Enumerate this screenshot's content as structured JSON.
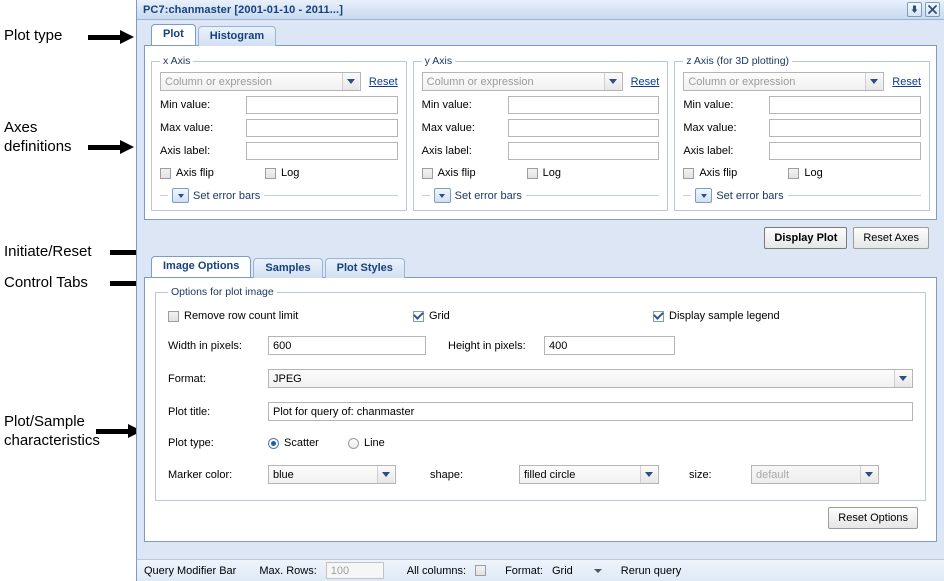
{
  "annotations": [
    {
      "text": "Plot type"
    },
    {
      "text": "Axes\ndefinitions"
    },
    {
      "text": "Initiate/Reset"
    },
    {
      "text": "Control Tabs"
    },
    {
      "text": "Plot/Sample\ncharacteristics"
    }
  ],
  "window": {
    "title": "PC7:chanmaster [2001-01-10 - 2011...]",
    "minimize_icon": "minimize-icon",
    "close_icon": "close-icon"
  },
  "plot_tabs": [
    {
      "label": "Plot",
      "active": true
    },
    {
      "label": "Histogram",
      "active": false
    }
  ],
  "axes": [
    {
      "legend": "x Axis",
      "column_placeholder": "Column or expression",
      "reset_label": "Reset",
      "min_label": "Min value:",
      "min_value": "",
      "max_label": "Max value:",
      "max_value": "",
      "axis_label_label": "Axis label:",
      "axis_label_value": "",
      "flip_label": "Axis flip",
      "flip_checked": false,
      "log_label": "Log",
      "log_checked": false,
      "error_bars_label": "Set error bars"
    },
    {
      "legend": "y Axis",
      "column_placeholder": "Column or expression",
      "reset_label": "Reset",
      "min_label": "Min value:",
      "min_value": "",
      "max_label": "Max value:",
      "max_value": "",
      "axis_label_label": "Axis label:",
      "axis_label_value": "",
      "flip_label": "Axis flip",
      "flip_checked": false,
      "log_label": "Log",
      "log_checked": false,
      "error_bars_label": "Set error bars"
    },
    {
      "legend": "z Axis (for 3D plotting)",
      "column_placeholder": "Column or expression",
      "reset_label": "Reset",
      "min_label": "Min value:",
      "min_value": "",
      "max_label": "Max value:",
      "max_value": "",
      "axis_label_label": "Axis label:",
      "axis_label_value": "",
      "flip_label": "Axis flip",
      "flip_checked": false,
      "log_label": "Log",
      "log_checked": false,
      "error_bars_label": "Set error bars"
    }
  ],
  "actions": {
    "display_plot": "Display Plot",
    "reset_axes": "Reset Axes"
  },
  "control_tabs": [
    {
      "label": "Image Options",
      "active": true
    },
    {
      "label": "Samples",
      "active": false
    },
    {
      "label": "Plot Styles",
      "active": false
    }
  ],
  "image_options": {
    "group_legend": "Options for plot image",
    "remove_row_limit_label": "Remove row count limit",
    "remove_row_limit_checked": false,
    "grid_label": "Grid",
    "grid_checked": true,
    "legend_label": "Display sample legend",
    "legend_checked": true,
    "width_label": "Width in pixels:",
    "width_value": "600",
    "height_label": "Height in pixels:",
    "height_value": "400",
    "format_label": "Format:",
    "format_value": "JPEG",
    "plot_title_label": "Plot title:",
    "plot_title_value": "Plot for query of: chanmaster",
    "plot_type_label": "Plot type:",
    "plot_type_scatter": "Scatter",
    "plot_type_line": "Line",
    "plot_type_selected": "Scatter",
    "marker_color_label": "Marker color:",
    "marker_color_value": "blue",
    "shape_label": "shape:",
    "shape_value": "filled circle",
    "size_label": "size:",
    "size_value": "default",
    "reset_options_label": "Reset Options"
  },
  "query_modifier_bar": {
    "title": "Query Modifier Bar",
    "max_rows_label": "Max. Rows:",
    "max_rows_value": "100",
    "all_columns_label": "All columns:",
    "all_columns_checked": false,
    "format_label": "Format:",
    "format_value": "Grid",
    "rerun_label": "Rerun query"
  },
  "colors": {
    "title_text": "#15417e",
    "window_bg": "#dce6f4",
    "panel_border": "#7a9cc6",
    "accent": "#1d5fa8"
  }
}
